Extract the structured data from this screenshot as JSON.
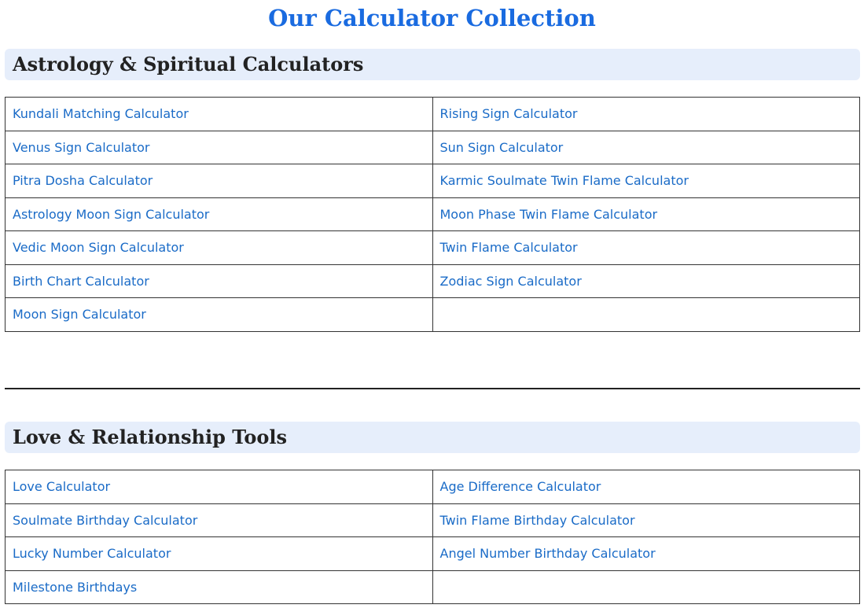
{
  "page": {
    "title": "Our Calculator Collection"
  },
  "sections": [
    {
      "heading": "Astrology & Spiritual Calculators",
      "rows": [
        [
          "Kundali Matching Calculator",
          "Rising Sign Calculator"
        ],
        [
          "Venus Sign Calculator",
          "Sun Sign Calculator"
        ],
        [
          "Pitra Dosha Calculator",
          "Karmic Soulmate Twin Flame Calculator"
        ],
        [
          "Astrology Moon Sign Calculator",
          "Moon Phase Twin Flame Calculator"
        ],
        [
          "Vedic Moon Sign Calculator",
          "Twin Flame Calculator"
        ],
        [
          "Birth Chart Calculator",
          "Zodiac Sign Calculator"
        ],
        [
          "Moon Sign Calculator",
          ""
        ]
      ]
    },
    {
      "heading": "Love & Relationship Tools",
      "rows": [
        [
          "Love Calculator",
          "Age Difference Calculator"
        ],
        [
          "Soulmate Birthday Calculator",
          "Twin Flame Birthday Calculator"
        ],
        [
          "Lucky Number Calculator",
          "Angel Number Birthday Calculator"
        ],
        [
          "Milestone Birthdays",
          ""
        ]
      ]
    }
  ],
  "colors": {
    "title": "#1a6be0",
    "link": "#1a6bc7",
    "header_bg": "#e6eefb",
    "heading_text": "#222222",
    "border": "#333333"
  }
}
